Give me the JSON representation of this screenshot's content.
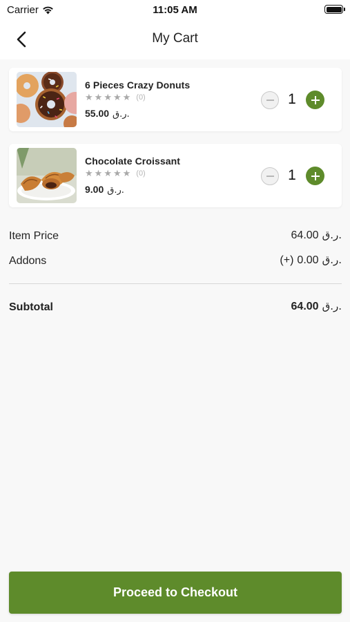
{
  "status_bar": {
    "carrier": "Carrier",
    "time": "11:05 AM"
  },
  "nav": {
    "title": "My Cart",
    "back_icon": "chevron-left-icon"
  },
  "cart": {
    "items": [
      {
        "name": "6 Pieces Crazy Donuts",
        "rating_count": "(0)",
        "stars_filled": 0,
        "stars_total": 5,
        "price": "55.00",
        "currency": "ر.ق.",
        "quantity": "1"
      },
      {
        "name": "Chocolate Croissant",
        "rating_count": "(0)",
        "stars_filled": 0,
        "stars_total": 5,
        "price": "9.00",
        "currency": "ر.ق.",
        "quantity": "1"
      }
    ]
  },
  "summary": {
    "item_price_label": "Item Price",
    "item_price_value": "64.00",
    "item_price_currency": "ر.ق.",
    "addons_label": "Addons",
    "addons_prefix": "(+)",
    "addons_value": "0.00",
    "addons_currency": "ر.ق.",
    "subtotal_label": "Subtotal",
    "subtotal_value": "64.00",
    "subtotal_currency": "ر.ق."
  },
  "checkout": {
    "label": "Proceed to Checkout"
  },
  "colors": {
    "accent": "#5e8b2b",
    "background": "#f8f8f8",
    "star": "#a9a9a9"
  }
}
